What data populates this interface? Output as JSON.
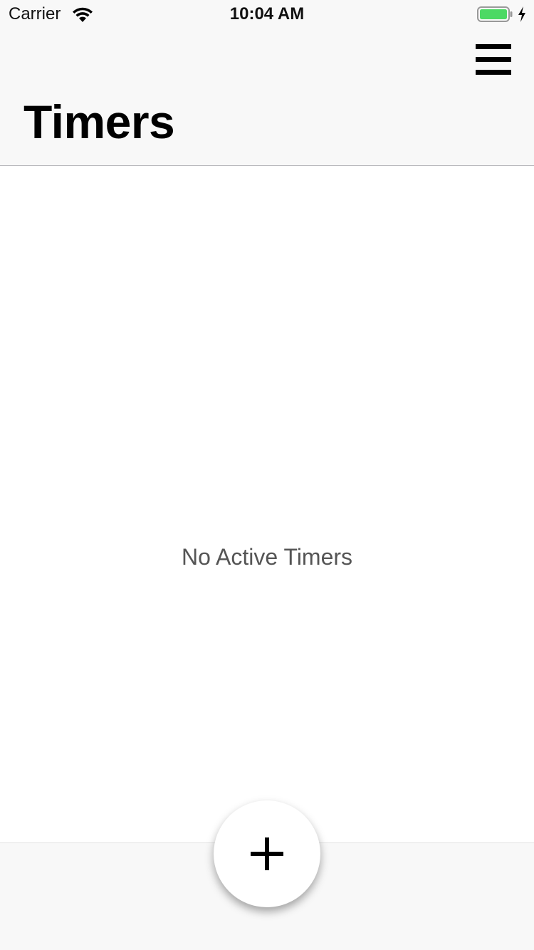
{
  "status_bar": {
    "carrier": "Carrier",
    "time": "10:04 AM",
    "battery_color": "#4cd964"
  },
  "nav_bar": {
    "title": "Timers",
    "menu_icon": "hamburger-menu-icon"
  },
  "main": {
    "empty_message": "No Active Timers"
  },
  "bottom_bar": {
    "add_icon": "plus-icon"
  }
}
